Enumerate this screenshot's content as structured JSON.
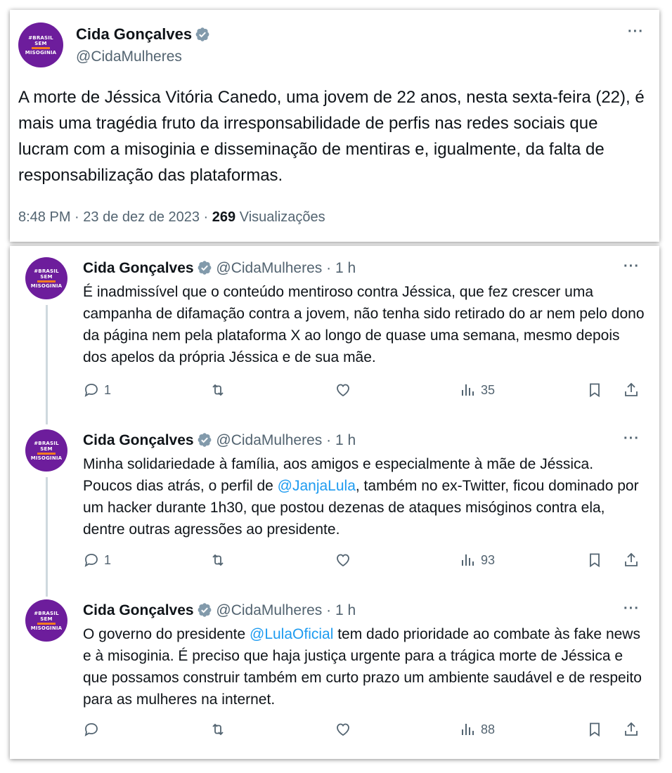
{
  "main_tweet": {
    "avatar": {
      "line1": "#BRASIL",
      "line2": "SEM",
      "line3": "MISOGINIA"
    },
    "name": "Cida Gonçalves",
    "handle": "@CidaMulheres",
    "text": "A morte de Jéssica Vitória Canedo, uma jovem de 22 anos, nesta sexta-feira (22), é mais uma tragédia fruto da irresponsabilidade de perfis nas redes sociais que lucram com a misoginia e disseminação de mentiras e, igualmente, da falta de responsabilização das plataformas.",
    "time": "8:48 PM",
    "date": "23 de dez de 2023",
    "views": "269",
    "views_label": "Visualizações",
    "sep": "·"
  },
  "thread": [
    {
      "name": "Cida Gonçalves",
      "handle": "@CidaMulheres",
      "time": "· 1 h",
      "text_before": "É inadmissível que o conteúdo mentiroso contra Jéssica, que fez crescer uma campanha de difamação contra a jovem, não tenha sido retirado do ar nem pelo dono da página nem pela plataforma X ao longo de quase uma semana, mesmo depois dos apelos da própria Jéssica e de sua mãe.",
      "replies": "1",
      "views": "35"
    },
    {
      "name": "Cida Gonçalves",
      "handle": "@CidaMulheres",
      "time": "· 1 h",
      "text_before": "Minha solidariedade à família, aos amigos e especialmente à mãe de Jéssica. Poucos dias atrás, o perfil de ",
      "mention": "@JanjaLula",
      "text_after": ", também no ex-Twitter, ficou dominado por um hacker durante 1h30, que postou dezenas de ataques misóginos contra ela, dentre outras agressões ao presidente.",
      "replies": "1",
      "views": "93"
    },
    {
      "name": "Cida Gonçalves",
      "handle": "@CidaMulheres",
      "time": "· 1 h",
      "text_before": "O governo do presidente ",
      "mention": "@LulaOficial",
      "text_after": " tem dado prioridade ao combate às fake news e à misoginia. É preciso que haja justiça urgente para a trágica morte de Jéssica e que possamos construir também em curto prazo um ambiente saudável e de respeito para as mulheres na internet.",
      "replies": "",
      "views": "88"
    }
  ],
  "colors": {
    "accent": "#1d9bf0",
    "muted": "#536471",
    "avatar_bg": "#6d1d9c",
    "avatar_bar": "#f47b20"
  },
  "more_label": "···"
}
